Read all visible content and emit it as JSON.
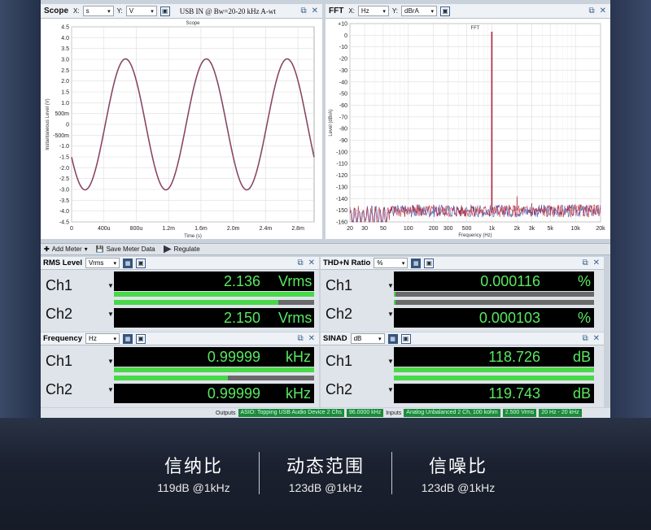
{
  "scope": {
    "title": "Scope",
    "x_label": "X:",
    "x_unit": "s",
    "y_label": "Y:",
    "y_unit": "V",
    "info": "USB IN @ Bw=20-20 kHz A-wt",
    "plot_title": "Scope",
    "xlabel": "Time (s)",
    "ylabel": "Instantaneous Level (V)",
    "y_ticks": [
      "4.5",
      "4.0",
      "3.5",
      "3.0",
      "2.5",
      "2.0",
      "1.5",
      "1.0",
      "500m",
      "0",
      "-500m",
      "-1.0",
      "-1.5",
      "-2.0",
      "-2.5",
      "-3.0",
      "-3.5",
      "-4.0",
      "-4.5"
    ],
    "x_ticks": [
      "0",
      "400u",
      "800u",
      "1.2m",
      "1.6m",
      "2.0m",
      "2.4m",
      "2.8m"
    ]
  },
  "fft": {
    "title": "FFT",
    "x_label": "X:",
    "x_unit": "Hz",
    "y_label": "Y:",
    "y_unit": "dBrA",
    "plot_title": "FFT",
    "xlabel": "Frequency (Hz)",
    "ylabel": "Level (dBrA)",
    "y_ticks": [
      "+10",
      "0",
      "-10",
      "-20",
      "-30",
      "-40",
      "-50",
      "-60",
      "-70",
      "-80",
      "-90",
      "-100",
      "-110",
      "-120",
      "-130",
      "-140",
      "-150",
      "-160"
    ],
    "x_ticks": [
      "20",
      "30",
      "50",
      "100",
      "200",
      "300",
      "500",
      "1k",
      "2k",
      "3k",
      "5k",
      "10k",
      "20k"
    ]
  },
  "chart_data": [
    {
      "type": "line",
      "title": "Scope",
      "xlabel": "Time (s)",
      "ylabel": "Instantaneous Level (V)",
      "xlim": [
        0,
        0.003
      ],
      "ylim": [
        -4.5,
        4.5
      ],
      "grid": true,
      "series": [
        {
          "amplitude": 3.02,
          "frequency_hz": 1000,
          "phase_deg": 210,
          "color": "#b03040"
        }
      ]
    },
    {
      "type": "line",
      "title": "FFT",
      "xlabel": "Frequency (Hz)",
      "ylabel": "Level (dBrA)",
      "x_scale": "log",
      "xlim": [
        20,
        20000
      ],
      "ylim": [
        -160,
        10
      ],
      "grid": true,
      "noise_floor": -150,
      "series": [
        {
          "color": "#c0202c",
          "x": [
            1000,
            2000,
            3000,
            5000
          ],
          "y": [
            3,
            -138,
            -144,
            -147
          ]
        },
        {
          "color": "#3040a0",
          "x": [
            1000,
            2000,
            3000,
            5000
          ],
          "y": [
            3,
            -141,
            -145,
            -148
          ]
        }
      ]
    }
  ],
  "toolbar": {
    "add_meter": "Add Meter",
    "save_meter": "Save Meter Data",
    "regulate": "Regulate"
  },
  "rms": {
    "title": "RMS Level",
    "unit_sel": "Vrms",
    "ch1": {
      "label": "Ch1",
      "value": "2.136",
      "unit": "Vrms",
      "bar": 1.0
    },
    "ch2": {
      "label": "Ch2",
      "value": "2.150",
      "unit": "Vrms",
      "bar": 0.82
    }
  },
  "thdn": {
    "title": "THD+N Ratio",
    "unit_sel": "%",
    "ch1": {
      "label": "Ch1",
      "value": "0.000116",
      "unit": "%",
      "bar": 0.01
    },
    "ch2": {
      "label": "Ch2",
      "value": "0.000103",
      "unit": "%",
      "bar": 0.01
    }
  },
  "freq": {
    "title": "Frequency",
    "unit_sel": "Hz",
    "ch1": {
      "label": "Ch1",
      "value": "0.99999",
      "unit": "kHz",
      "bar": 1.0
    },
    "ch2": {
      "label": "Ch2",
      "value": "0.99999",
      "unit": "kHz",
      "bar": 0.57
    }
  },
  "sinad": {
    "title": "SINAD",
    "unit_sel": "dB",
    "ch1": {
      "label": "Ch1",
      "value": "118.726",
      "unit": "dB",
      "bar": 1.0
    },
    "ch2": {
      "label": "Ch2",
      "value": "119.743",
      "unit": "dB",
      "bar": 1.0
    }
  },
  "status": {
    "outputs": "Outputs",
    "device": "ASIO: Topping USB Audio Device 2 Chs",
    "rate": "96.0000 kHz",
    "inputs": "Inputs",
    "input_cfg": "Analog Unbalanced 2 Ch, 100 kohm",
    "range": "2.500 Vrms",
    "bw": "20 Hz - 20 kHz"
  },
  "specs": [
    {
      "title": "信纳比",
      "value": "119dB @1kHz"
    },
    {
      "title": "动态范围",
      "value": "123dB @1kHz"
    },
    {
      "title": "信噪比",
      "value": "123dB @1kHz"
    }
  ],
  "colors": {
    "meter_green": "#59e860",
    "bar_green": "#48d848",
    "trace_red": "#b03040",
    "trace_blue": "#3040a0"
  }
}
